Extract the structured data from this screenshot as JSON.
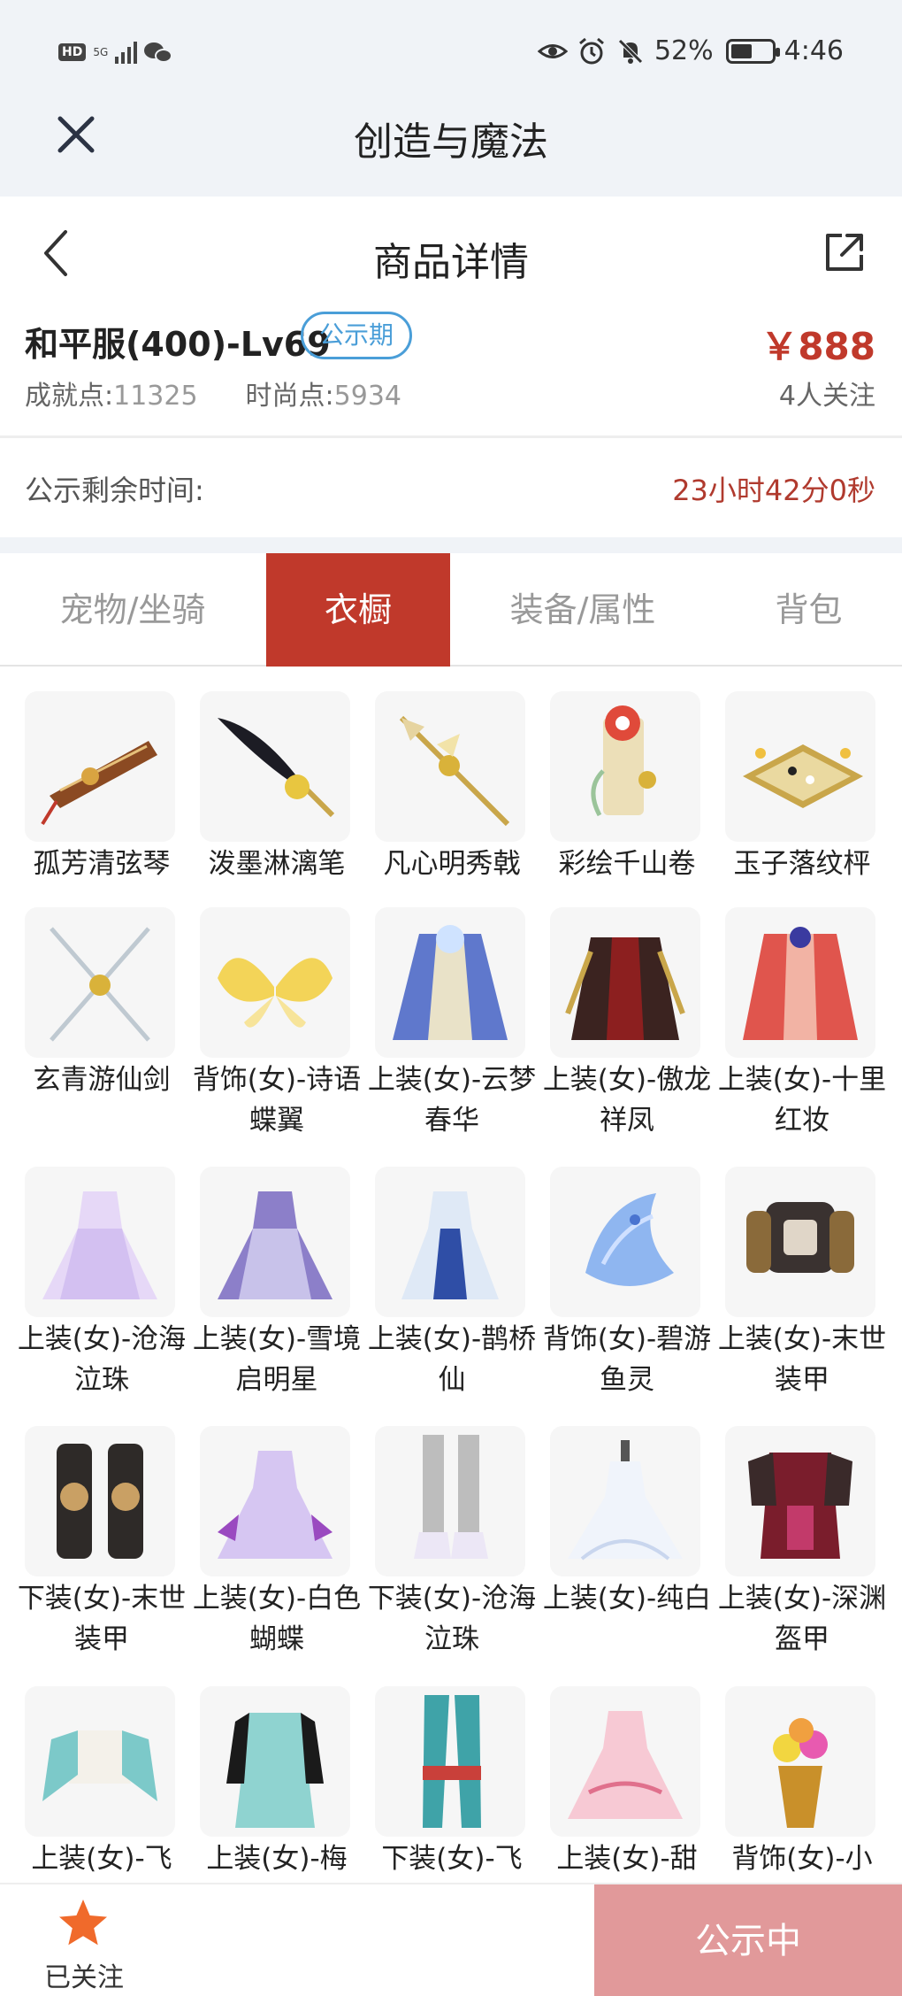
{
  "status_bar": {
    "hd": "HD",
    "network": "5G",
    "battery_text": "52%",
    "battery_level": 0.52,
    "time": "4:46"
  },
  "app": {
    "title": "创造与魔法"
  },
  "nav": {
    "title": "商品详情"
  },
  "product": {
    "name": "和平服(400)-Lv69",
    "badge": "公示期",
    "price": "￥888",
    "achievement_label": "成就点:",
    "achievement_value": "11325",
    "fashion_label": "时尚点:",
    "fashion_value": "5934",
    "followers": "4人关注"
  },
  "countdown": {
    "label": "公示剩余时间:",
    "value": "23小时42分0秒"
  },
  "tabs": [
    {
      "label": "宠物/坐骑",
      "active": false
    },
    {
      "label": "衣橱",
      "active": true
    },
    {
      "label": "装备/属性",
      "active": false
    },
    {
      "label": "背包",
      "active": false
    }
  ],
  "items": [
    {
      "name": "孤芳清弦琴",
      "icon": "instrument-icon"
    },
    {
      "name": "泼墨淋漓笔",
      "icon": "brush-icon"
    },
    {
      "name": "凡心明秀戟",
      "icon": "halberd-icon"
    },
    {
      "name": "彩绘千山卷",
      "icon": "scroll-icon"
    },
    {
      "name": "玉子落纹枰",
      "icon": "go-board-icon"
    },
    {
      "name": "玄青游仙剑",
      "icon": "twin-swords-icon"
    },
    {
      "name": "背饰(女)-诗语蝶翼",
      "icon": "butterfly-wings-icon"
    },
    {
      "name": "上装(女)-云梦春华",
      "icon": "robe-blue-icon"
    },
    {
      "name": "上装(女)-傲龙祥凤",
      "icon": "robe-dark-icon"
    },
    {
      "name": "上装(女)-十里红妆",
      "icon": "robe-red-icon"
    },
    {
      "name": "上装(女)-沧海泣珠",
      "icon": "dress-lilac-icon"
    },
    {
      "name": "上装(女)-雪境启明星",
      "icon": "dress-purple-icon"
    },
    {
      "name": "上装(女)-鹊桥仙",
      "icon": "dress-blue-icon"
    },
    {
      "name": "背饰(女)-碧游鱼灵",
      "icon": "water-fish-icon"
    },
    {
      "name": "上装(女)-末世装甲",
      "icon": "armor-top-icon"
    },
    {
      "name": "下装(女)-末世装甲",
      "icon": "armor-pants-icon"
    },
    {
      "name": "上装(女)-白色蝴蝶",
      "icon": "dress-butterfly-icon"
    },
    {
      "name": "下装(女)-沧海泣珠",
      "icon": "boots-icon"
    },
    {
      "name": "上装(女)-纯白",
      "icon": "dress-white-icon"
    },
    {
      "name": "上装(女)-深渊盔甲",
      "icon": "armor-crimson-icon"
    },
    {
      "name": "上装(女)-飞",
      "icon": "top-teal-icon"
    },
    {
      "name": "上装(女)-梅",
      "icon": "coat-mint-icon"
    },
    {
      "name": "下装(女)-飞",
      "icon": "pants-teal-icon"
    },
    {
      "name": "上装(女)-甜",
      "icon": "dress-pink-icon"
    },
    {
      "name": "背饰(女)-小",
      "icon": "flower-basket-icon"
    }
  ],
  "bottom": {
    "follow_label": "已关注",
    "status_label": "公示中"
  },
  "colors": {
    "accent": "#c0392b",
    "badge": "#4a9ed8",
    "status_button": "#e1999a"
  }
}
